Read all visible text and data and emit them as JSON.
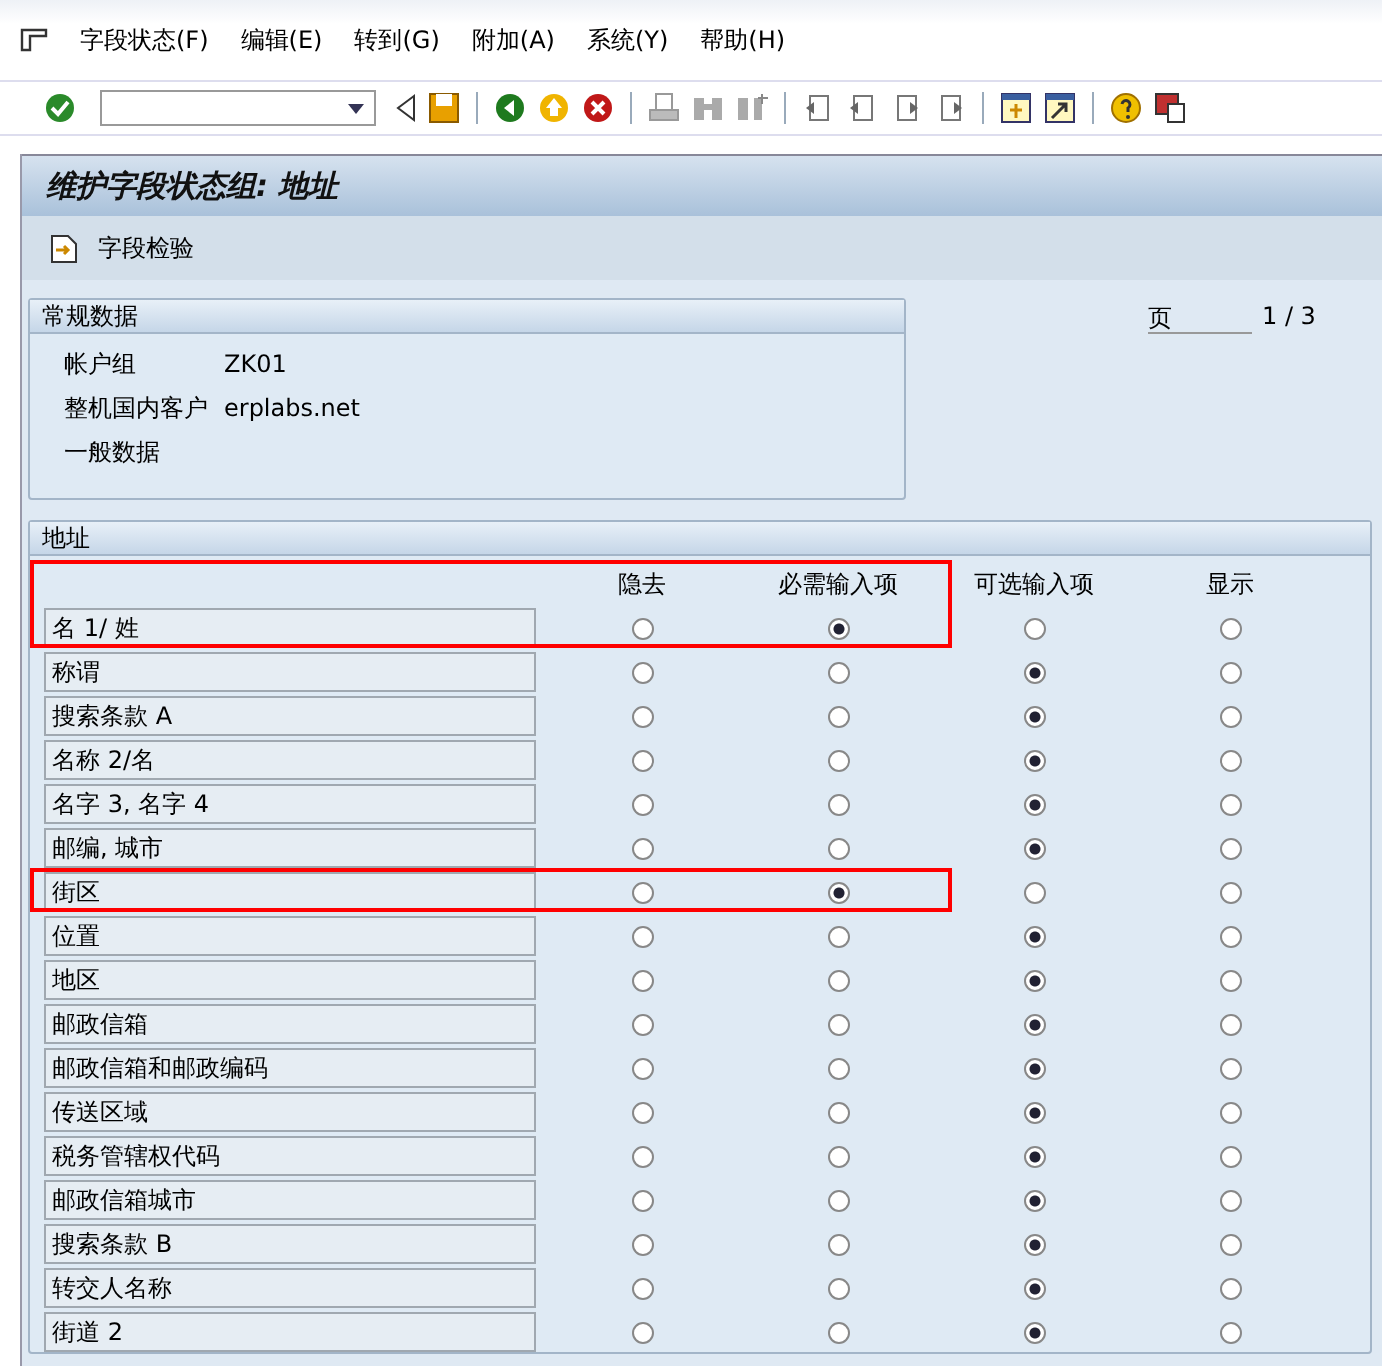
{
  "menu_bar": {
    "items": [
      "字段状态(F)",
      "编辑(E)",
      "转到(G)",
      "附加(A)",
      "系统(Y)",
      "帮助(H)"
    ]
  },
  "title": "维护字段状态组: 地址",
  "app_toolbar": {
    "buttons": [
      "字段检验"
    ]
  },
  "general_data": {
    "title": "常规数据",
    "fields": [
      {
        "label": "帐户组",
        "value": "ZK01"
      },
      {
        "label": "整机国内客户",
        "value": "erplabs.net"
      }
    ],
    "note": "一般数据"
  },
  "page": {
    "label": "页",
    "position": "1 / 3"
  },
  "address": {
    "title": "地址",
    "columns": [
      "隐去",
      "必需输入项",
      "可选输入项",
      "显示"
    ],
    "rows": [
      {
        "label": "名 1/ 姓",
        "highlighted": true,
        "options": [
          {
            "selected": false
          },
          {
            "selected": true
          },
          {
            "selected": false
          },
          {
            "selected": false
          }
        ]
      },
      {
        "label": "称谓",
        "highlighted": false,
        "options": [
          {
            "selected": false
          },
          {
            "selected": false
          },
          {
            "selected": true
          },
          {
            "selected": false
          }
        ]
      },
      {
        "label": "搜索条款 A",
        "highlighted": false,
        "options": [
          {
            "selected": false
          },
          {
            "selected": false
          },
          {
            "selected": true
          },
          {
            "selected": false
          }
        ]
      },
      {
        "label": "名称 2/名",
        "highlighted": false,
        "options": [
          {
            "selected": false
          },
          {
            "selected": false
          },
          {
            "selected": true
          },
          {
            "selected": false
          }
        ]
      },
      {
        "label": "名字 3, 名字 4",
        "highlighted": false,
        "options": [
          {
            "selected": false
          },
          {
            "selected": false
          },
          {
            "selected": true
          },
          {
            "selected": false
          }
        ]
      },
      {
        "label": "邮编, 城市",
        "highlighted": false,
        "options": [
          {
            "selected": false
          },
          {
            "selected": false
          },
          {
            "selected": true
          },
          {
            "selected": false
          }
        ]
      },
      {
        "label": "街区",
        "highlighted": true,
        "options": [
          {
            "selected": false
          },
          {
            "selected": true
          },
          {
            "selected": false
          },
          {
            "selected": false
          }
        ]
      },
      {
        "label": "位置",
        "highlighted": false,
        "options": [
          {
            "selected": false
          },
          {
            "selected": false
          },
          {
            "selected": true
          },
          {
            "selected": false
          }
        ]
      },
      {
        "label": "地区",
        "highlighted": false,
        "options": [
          {
            "selected": false
          },
          {
            "selected": false
          },
          {
            "selected": true
          },
          {
            "selected": false
          }
        ]
      },
      {
        "label": "邮政信箱",
        "highlighted": false,
        "options": [
          {
            "selected": false
          },
          {
            "selected": false
          },
          {
            "selected": true
          },
          {
            "selected": false
          }
        ]
      },
      {
        "label": "邮政信箱和邮政编码",
        "highlighted": false,
        "options": [
          {
            "selected": false
          },
          {
            "selected": false
          },
          {
            "selected": true
          },
          {
            "selected": false
          }
        ]
      },
      {
        "label": "传送区域",
        "highlighted": false,
        "options": [
          {
            "selected": false
          },
          {
            "selected": false
          },
          {
            "selected": true
          },
          {
            "selected": false
          }
        ]
      },
      {
        "label": "税务管辖权代码",
        "highlighted": false,
        "options": [
          {
            "selected": false
          },
          {
            "selected": false
          },
          {
            "selected": true
          },
          {
            "selected": false
          }
        ]
      },
      {
        "label": "邮政信箱城市",
        "highlighted": false,
        "options": [
          {
            "selected": false
          },
          {
            "selected": false
          },
          {
            "selected": true
          },
          {
            "selected": false
          }
        ]
      },
      {
        "label": "搜索条款 B",
        "highlighted": false,
        "options": [
          {
            "selected": false
          },
          {
            "selected": false
          },
          {
            "selected": true
          },
          {
            "selected": false
          }
        ]
      },
      {
        "label": "转交人名称",
        "highlighted": false,
        "options": [
          {
            "selected": false
          },
          {
            "selected": false
          },
          {
            "selected": true
          },
          {
            "selected": false
          }
        ]
      },
      {
        "label": "街道 2",
        "highlighted": false,
        "options": [
          {
            "selected": false
          },
          {
            "selected": false
          },
          {
            "selected": true
          },
          {
            "selected": false
          }
        ]
      }
    ]
  }
}
